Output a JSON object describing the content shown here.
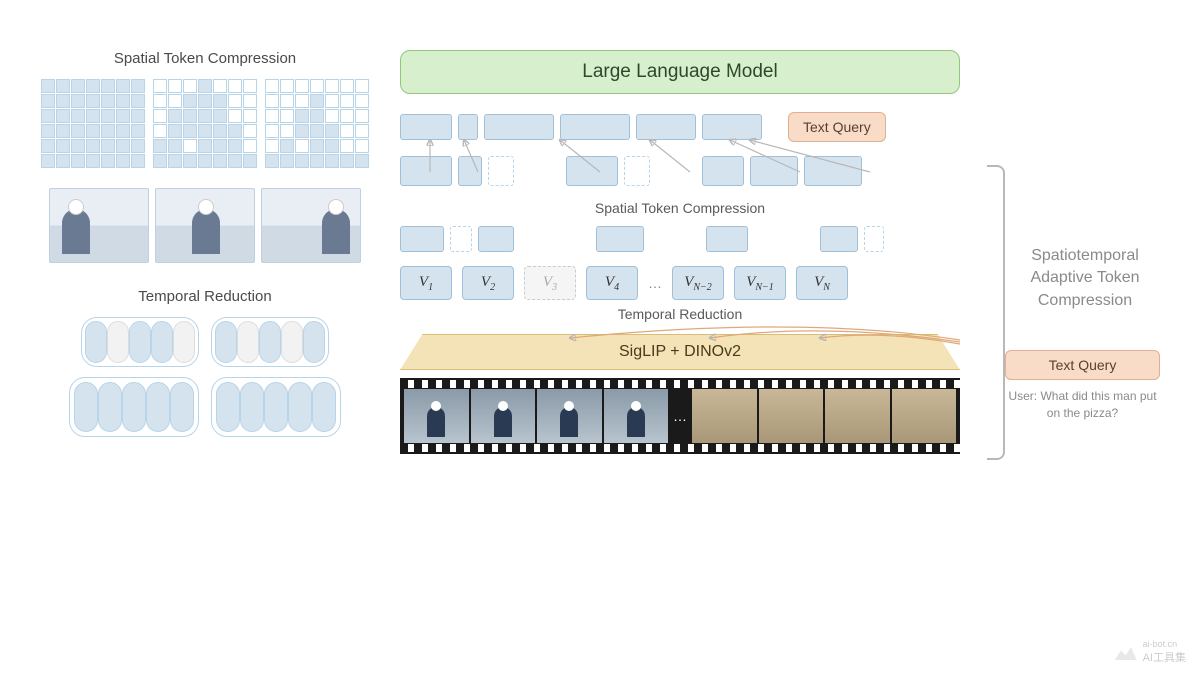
{
  "left": {
    "spatial_title": "Spatial Token Compression",
    "temporal_title": "Temporal Reduction"
  },
  "right": {
    "llm": "Large Language Model",
    "text_query": "Text Query",
    "spatial_label": "Spatial Token Compression",
    "temporal_label": "Temporal Reduction",
    "encoder": "SigLIP + DINOv2",
    "v_tokens": [
      "V₁",
      "V₂",
      "V₃",
      "V₄",
      "V_{N-2}",
      "V_{N-1}",
      "V_N"
    ],
    "side_label": "Spatiotemporal Adaptive Token Compression",
    "user_question": "User: What did this man put on the pizza?"
  },
  "watermark": "AI工具集",
  "watermark_url": "ai-bot.cn"
}
